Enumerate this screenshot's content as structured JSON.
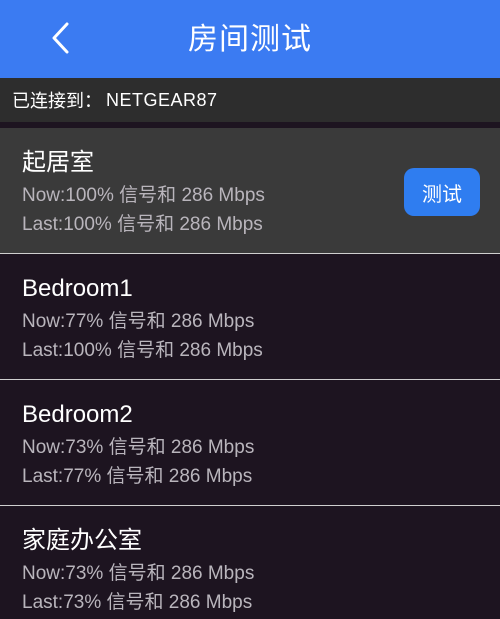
{
  "header": {
    "title": "房间测试",
    "back_icon": "chevron-left-icon"
  },
  "connection": {
    "label": "已连接到：",
    "ssid": "NETGEAR87"
  },
  "rooms": [
    {
      "name": "起居室",
      "now": "Now:100% 信号和 286 Mbps",
      "last": "Last:100% 信号和 286 Mbps",
      "test_label": "测试"
    },
    {
      "name": "Bedroom1",
      "now": "Now:77% 信号和 286 Mbps",
      "last": "Last:100% 信号和 286 Mbps"
    },
    {
      "name": "Bedroom2",
      "now": "Now:73% 信号和 286 Mbps",
      "last": "Last:77% 信号和 286 Mbps"
    },
    {
      "name": "家庭办公室",
      "now": "Now:73% 信号和 286 Mbps",
      "last": "Last:73% 信号和 286 Mbps"
    }
  ],
  "colors": {
    "header": "#3b7bf2",
    "button": "#2f7df0",
    "background": "#1d1420",
    "selected_row": "#3a3a3a"
  }
}
